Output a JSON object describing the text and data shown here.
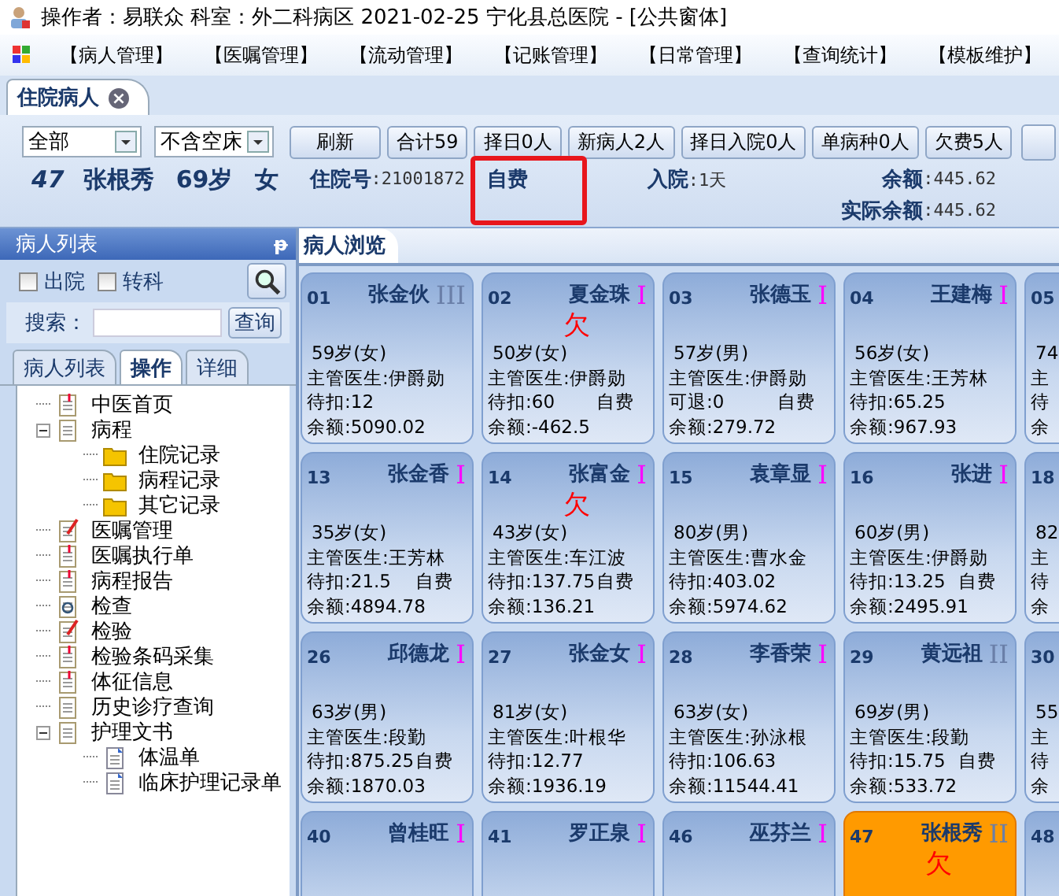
{
  "window": {
    "title": "操作者：易联众  科室：外二科病区   2021-02-25  宁化县总医院 - [公共窗体]"
  },
  "menu": [
    "【病人管理】",
    "【医嘱管理】",
    "【流动管理】",
    "【记账管理】",
    "【日常管理】",
    "【查询统计】",
    "【模板维护】"
  ],
  "doc_tab": {
    "label": "住院病人",
    "close": "×"
  },
  "filters": [
    {
      "value": "全部"
    },
    {
      "value": "不含空床"
    }
  ],
  "toolbar_buttons": [
    "刷新",
    "合计59",
    "择日0人",
    "新病人2人",
    "择日入院0人",
    "单病种0人",
    "欠费5人"
  ],
  "patient": {
    "bed": "47",
    "name": "张根秀",
    "age": "69岁",
    "sex": "女",
    "admission_label": "住院号",
    "admission_no": ":21001872",
    "payment": "自费",
    "days_label": "入院",
    "days": ":1天",
    "balance_label": "余额",
    "balance": ":445.62",
    "actual_label": "实际余额",
    "actual": ":445.62"
  },
  "side": {
    "title": "病人列表",
    "pin": "ᵽ",
    "checks": [
      {
        "label": "出院",
        "checked": false
      },
      {
        "label": "转科",
        "checked": false
      }
    ],
    "search_label": "搜索：",
    "search_button": "查询",
    "tabs": [
      {
        "label": "病人列表",
        "selected": false
      },
      {
        "label": "操作",
        "selected": true
      },
      {
        "label": "详细",
        "selected": false
      }
    ],
    "tree": [
      {
        "label": "中医首页",
        "kind": "doc"
      },
      {
        "label": "病程",
        "kind": "notes",
        "expanded": true,
        "children": [
          {
            "label": "住院记录",
            "kind": "folder"
          },
          {
            "label": "病程记录",
            "kind": "folder"
          },
          {
            "label": "其它记录",
            "kind": "folder"
          }
        ]
      },
      {
        "label": "医嘱管理",
        "kind": "edit"
      },
      {
        "label": "医嘱执行单",
        "kind": "doc"
      },
      {
        "label": "病程报告",
        "kind": "doc"
      },
      {
        "label": "检查",
        "kind": "search"
      },
      {
        "label": "检验",
        "kind": "edit"
      },
      {
        "label": "检验条码采集",
        "kind": "doc"
      },
      {
        "label": "体征信息",
        "kind": "doc"
      },
      {
        "label": "历史诊疗查询",
        "kind": "clip"
      },
      {
        "label": "护理文书",
        "kind": "clip",
        "expanded": true,
        "children": [
          {
            "label": "体温单",
            "kind": "page"
          },
          {
            "label": "临床护理记录单",
            "kind": "page"
          }
        ]
      }
    ]
  },
  "browse_tab": "病人浏览",
  "cards": [
    {
      "bed": "01",
      "name": "张金伙",
      "level": "III",
      "color": "#6a7fa8",
      "selected": false,
      "age": "59岁(女)",
      "doctor": "主管医生:伊爵勋",
      "pending": "待扣:12",
      "balance": "余额:5090.02"
    },
    {
      "bed": "02",
      "name": "夏金珠",
      "level": "I",
      "color": "#ff00ff",
      "arrears": "欠",
      "selected": false,
      "age": "50岁(女)",
      "doctor": "主管医生:伊爵勋",
      "pending": "待扣:60",
      "pay": "自费",
      "balance": "余额:-462.5"
    },
    {
      "bed": "03",
      "name": "张德玉",
      "level": "I",
      "color": "#ff00ff",
      "arrears": false,
      "selected": false,
      "age": "57岁(男)",
      "doctor": "主管医生:伊爵勋",
      "pending": "可退:0",
      "pay": "自费",
      "balance": "余额:279.72"
    },
    {
      "bed": "04",
      "name": "王建梅",
      "level": "I",
      "color": "#ff00ff",
      "arrears": false,
      "selected": false,
      "age": "56岁(女)",
      "doctor": "主管医生:王芳林",
      "pending": "待扣:65.25",
      "balance": "余额:967.93"
    },
    {
      "bed": "05",
      "kind": "partial",
      "age": "74",
      "doctor": "主",
      "pending": "待",
      "balance": "余"
    },
    {
      "bed": "13",
      "name": "张金香",
      "level": "I",
      "color": "#ff00ff",
      "arrears": false,
      "selected": false,
      "age": "35岁(女)",
      "doctor": "主管医生:王芳林",
      "pending": "待扣:21.5",
      "pay": "自费",
      "balance": "余额:4894.78"
    },
    {
      "bed": "14",
      "name": "张富金",
      "level": "I",
      "color": "#ff00ff",
      "arrears": "欠",
      "selected": false,
      "age": "43岁(女)",
      "doctor": "主管医生:车江波",
      "pending": "待扣:137.75",
      "pay": "自费",
      "balance": "余额:136.21"
    },
    {
      "bed": "15",
      "name": "袁章显",
      "level": "I",
      "color": "#ff00ff",
      "arrears": false,
      "selected": false,
      "age": "80岁(男)",
      "doctor": "主管医生:曹水金",
      "pending": "待扣:403.02",
      "balance": "余额:5974.62"
    },
    {
      "bed": "16",
      "name": "张进",
      "level": "I",
      "color": "#ff00ff",
      "arrears": false,
      "selected": false,
      "age": "60岁(男)",
      "doctor": "主管医生:伊爵勋",
      "pending": "待扣:13.25",
      "pay": "自费",
      "balance": "余额:2495.91"
    },
    {
      "bed": "18",
      "kind": "partial",
      "age": "82",
      "doctor": "主",
      "pending": "待",
      "balance": "余"
    },
    {
      "bed": "26",
      "name": "邱德龙",
      "level": "I",
      "color": "#ff00ff",
      "arrears": false,
      "selected": false,
      "age": "63岁(男)",
      "doctor": "主管医生:段勤",
      "pending": "待扣:875.25",
      "pay": "自费",
      "balance": "余额:1870.03"
    },
    {
      "bed": "27",
      "name": "张金女",
      "level": "I",
      "color": "#ff00ff",
      "arrears": false,
      "selected": false,
      "age": "81岁(女)",
      "doctor": "主管医生:叶根华",
      "pending": "待扣:12.77",
      "balance": "余额:1936.19"
    },
    {
      "bed": "28",
      "name": "李香荣",
      "level": "I",
      "color": "#ff00ff",
      "arrears": false,
      "selected": false,
      "age": "63岁(女)",
      "doctor": "主管医生:孙泳根",
      "pending": "待扣:106.63",
      "balance": "余额:11544.41"
    },
    {
      "bed": "29",
      "name": "黄远祖",
      "level": "II",
      "color": "#6a7fa8",
      "arrears": false,
      "selected": false,
      "age": "69岁(男)",
      "doctor": "主管医生:段勤",
      "pending": "待扣:15.75",
      "pay": "自费",
      "balance": "余额:533.72"
    },
    {
      "bed": "30",
      "kind": "partial",
      "age": "55",
      "doctor": "主",
      "pending": "待",
      "balance": "余"
    },
    {
      "bed": "40",
      "name": "曾桂旺",
      "level": "I",
      "color": "#ff00ff",
      "arrears": false,
      "selected": false
    },
    {
      "bed": "41",
      "name": "罗正泉",
      "level": "I",
      "color": "#ff00ff",
      "arrears": false,
      "selected": false
    },
    {
      "bed": "46",
      "name": "巫芬兰",
      "level": "I",
      "color": "#ff00ff",
      "arrears": false,
      "selected": false
    },
    {
      "bed": "47",
      "name": "张根秀",
      "level": "II",
      "color": "#6a7fa8",
      "arrears": "欠",
      "selected": true
    },
    {
      "bed": "48",
      "kind": "partial"
    }
  ]
}
